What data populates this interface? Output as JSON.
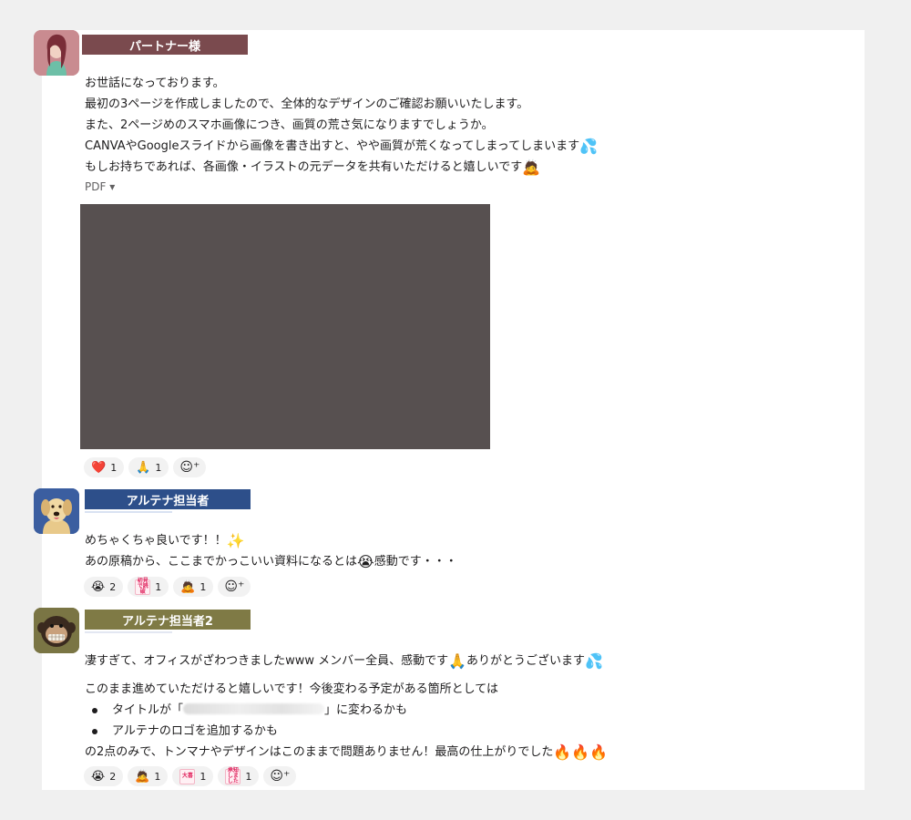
{
  "thread": [
    {
      "author": "パートナー様",
      "banner_color": "#7a4a4e",
      "lines": [
        "お世話になっております。",
        "最初の3ページを作成しましたので、全体的なデザインのご確認お願いいたします。",
        "また、2ページめのスマホ画像につき、画質の荒さ気になりますでしょうか。",
        "CANVAやGoogleスライドから画像を書き出すと、やや画質が荒くなってしまってしまいます",
        "もしお持ちであれば、各画像・イラストの元データを共有いただけると嬉しいです"
      ],
      "attachment_label": "PDF ▾",
      "reactions": [
        {
          "emoji": "❤️",
          "count": "1"
        },
        {
          "emoji": "🙏",
          "count": "1"
        }
      ]
    },
    {
      "author": "アルテナ担当者",
      "banner_color": "#2d4f8a",
      "lines": [
        "めちゃくちゃ良いです！！",
        "あの原稿から、ここまでかっこいい資料になるとは",
        "感動です・・・"
      ],
      "reactions": [
        {
          "emoji": "😭",
          "count": "2"
        },
        {
          "emoji": "初見で読破",
          "count": "1"
        },
        {
          "emoji": "🙇",
          "count": "1"
        }
      ]
    },
    {
      "author": "アルテナ担当者2",
      "banner_color": "#7f7a45",
      "line1_a": "凄すぎて、オフィスがざわつきましたwww メンバー全員、感動です",
      "line1_b": "ありがとうございます",
      "line2": "このまま進めていただけると嬉しいです！今後変わる予定がある箇所としては",
      "bullets": [
        {
          "prefix": "タイトルが「",
          "suffix": "」に変わるかも"
        },
        {
          "prefix": "アルテナのロゴを追加するかも",
          "suffix": ""
        }
      ],
      "line3": "の2点のみで、トンマナやデザインはこのままで問題ありません！最高の仕上がりでした",
      "reactions": [
        {
          "emoji": "😭",
          "count": "2"
        },
        {
          "emoji": "🙇",
          "count": "1"
        },
        {
          "emoji": "大喜",
          "count": "1"
        },
        {
          "emoji": "承知しました",
          "count": "1"
        }
      ]
    }
  ],
  "emojis": {
    "sweat": "💦",
    "bow": "🙇",
    "sparkles": "✨",
    "crying": "😭",
    "pray": "🙏",
    "fire": "🔥"
  },
  "add_reaction_icon": "☺⁺"
}
